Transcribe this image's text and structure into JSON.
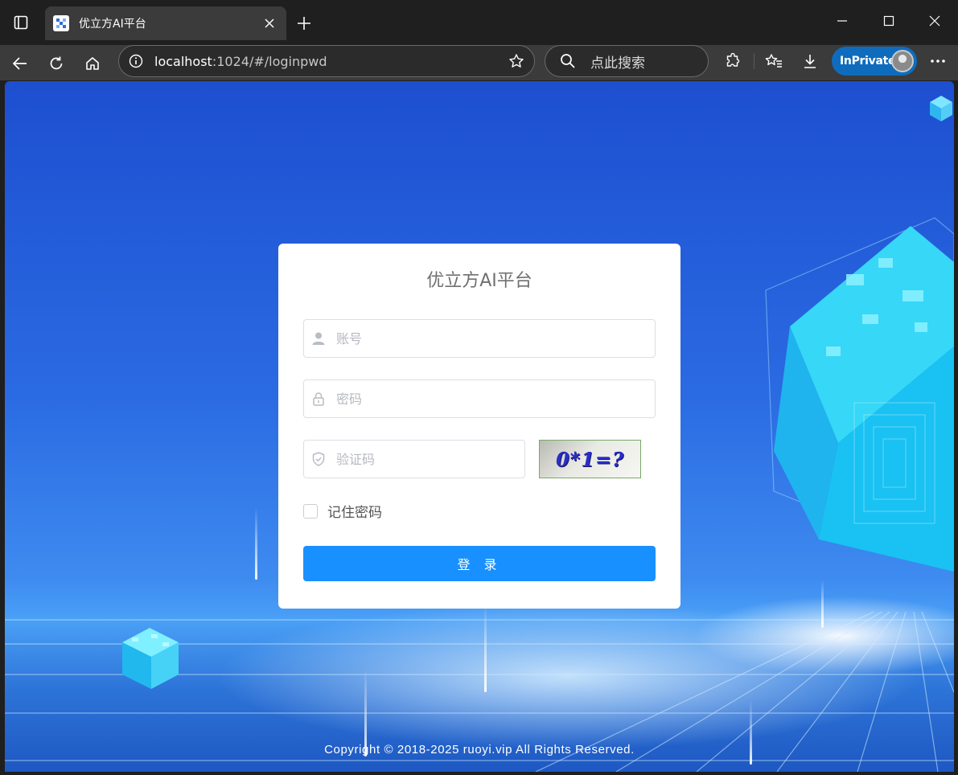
{
  "browser": {
    "tab_title": "优立方AI平台",
    "url_host": "localhost",
    "url_path": ":1024/#/loginpwd",
    "search_placeholder": "点此搜索",
    "inprivate_label": "InPrivate",
    "icons": [
      "tab-actions-icon",
      "favicon-icon",
      "close-tab-icon",
      "new-tab-icon",
      "minimize-icon",
      "maximize-icon",
      "close-window-icon",
      "back-icon",
      "refresh-icon",
      "home-icon",
      "site-info-icon",
      "favorite-star-icon",
      "search-icon",
      "extensions-icon",
      "favorites-icon",
      "downloads-icon",
      "more-icon"
    ]
  },
  "login": {
    "title": "优立方AI平台",
    "username_placeholder": "账号",
    "password_placeholder": "密码",
    "captcha_placeholder": "验证码",
    "captcha_text": "0*1=?",
    "remember_label": "记住密码",
    "submit_label": "登 录"
  },
  "footer": {
    "copyright": "Copyright © 2018-2025 ruoyi.vip All Rights Reserved."
  },
  "colors": {
    "primary": "#1890ff",
    "chrome_dark": "#1f1f1f",
    "chrome_tab": "#3b3b3b",
    "inprivate": "#0f6cbd"
  }
}
